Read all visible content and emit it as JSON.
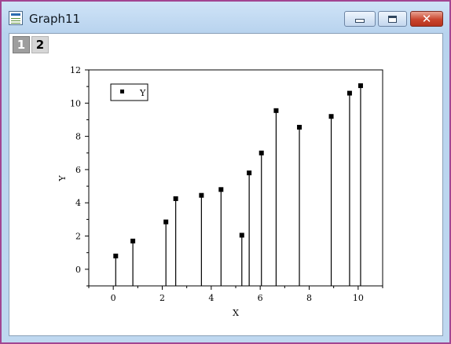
{
  "window": {
    "title": "Graph11",
    "icon": "graph-window-icon",
    "controls": [
      "minimize-icon",
      "maximize-icon",
      "close-icon"
    ]
  },
  "layers": {
    "tab1": "1",
    "tab2": "2"
  },
  "chart_data": {
    "type": "scatter",
    "style": "drop-lines",
    "xlabel": "X",
    "ylabel": "Y",
    "xlim": [
      -1,
      11
    ],
    "ylim": [
      -1,
      12
    ],
    "xticks": [
      "0",
      "2",
      "4",
      "6",
      "8",
      "10"
    ],
    "yticks": [
      "0",
      "2",
      "4",
      "6",
      "8",
      "10",
      "12"
    ],
    "grid": false,
    "legend": {
      "placement": "top-left",
      "entries": [
        "Y"
      ]
    },
    "series": [
      {
        "name": "Y",
        "x": [
          0.1,
          0.8,
          2.15,
          2.55,
          3.6,
          4.4,
          5.25,
          5.55,
          6.05,
          6.65,
          7.6,
          8.9,
          9.65,
          10.1
        ],
        "y": [
          0.8,
          1.7,
          2.85,
          4.25,
          4.45,
          4.8,
          2.05,
          5.8,
          7.0,
          9.55,
          8.55,
          9.2,
          10.6,
          11.05
        ]
      }
    ]
  }
}
